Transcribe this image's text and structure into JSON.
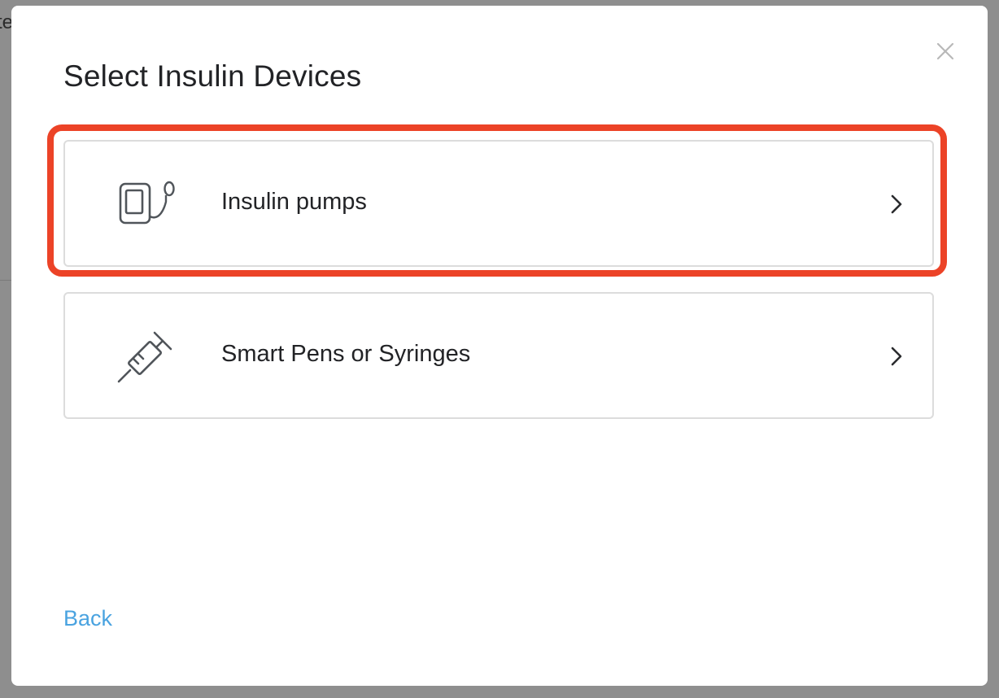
{
  "background": {
    "partial_text": "te"
  },
  "dialog": {
    "title": "Select Insulin Devices",
    "close_icon": "close-icon",
    "options": [
      {
        "label": "Insulin pumps",
        "icon": "insulin-pump-icon",
        "highlighted": true
      },
      {
        "label": "Smart Pens or Syringes",
        "icon": "syringe-icon",
        "highlighted": false
      }
    ],
    "back_label": "Back"
  },
  "colors": {
    "highlight": "#ec4327",
    "link": "#4aa3e0",
    "text": "#222326",
    "border": "#dcdcdc",
    "overlay": "#8e8e8e"
  }
}
